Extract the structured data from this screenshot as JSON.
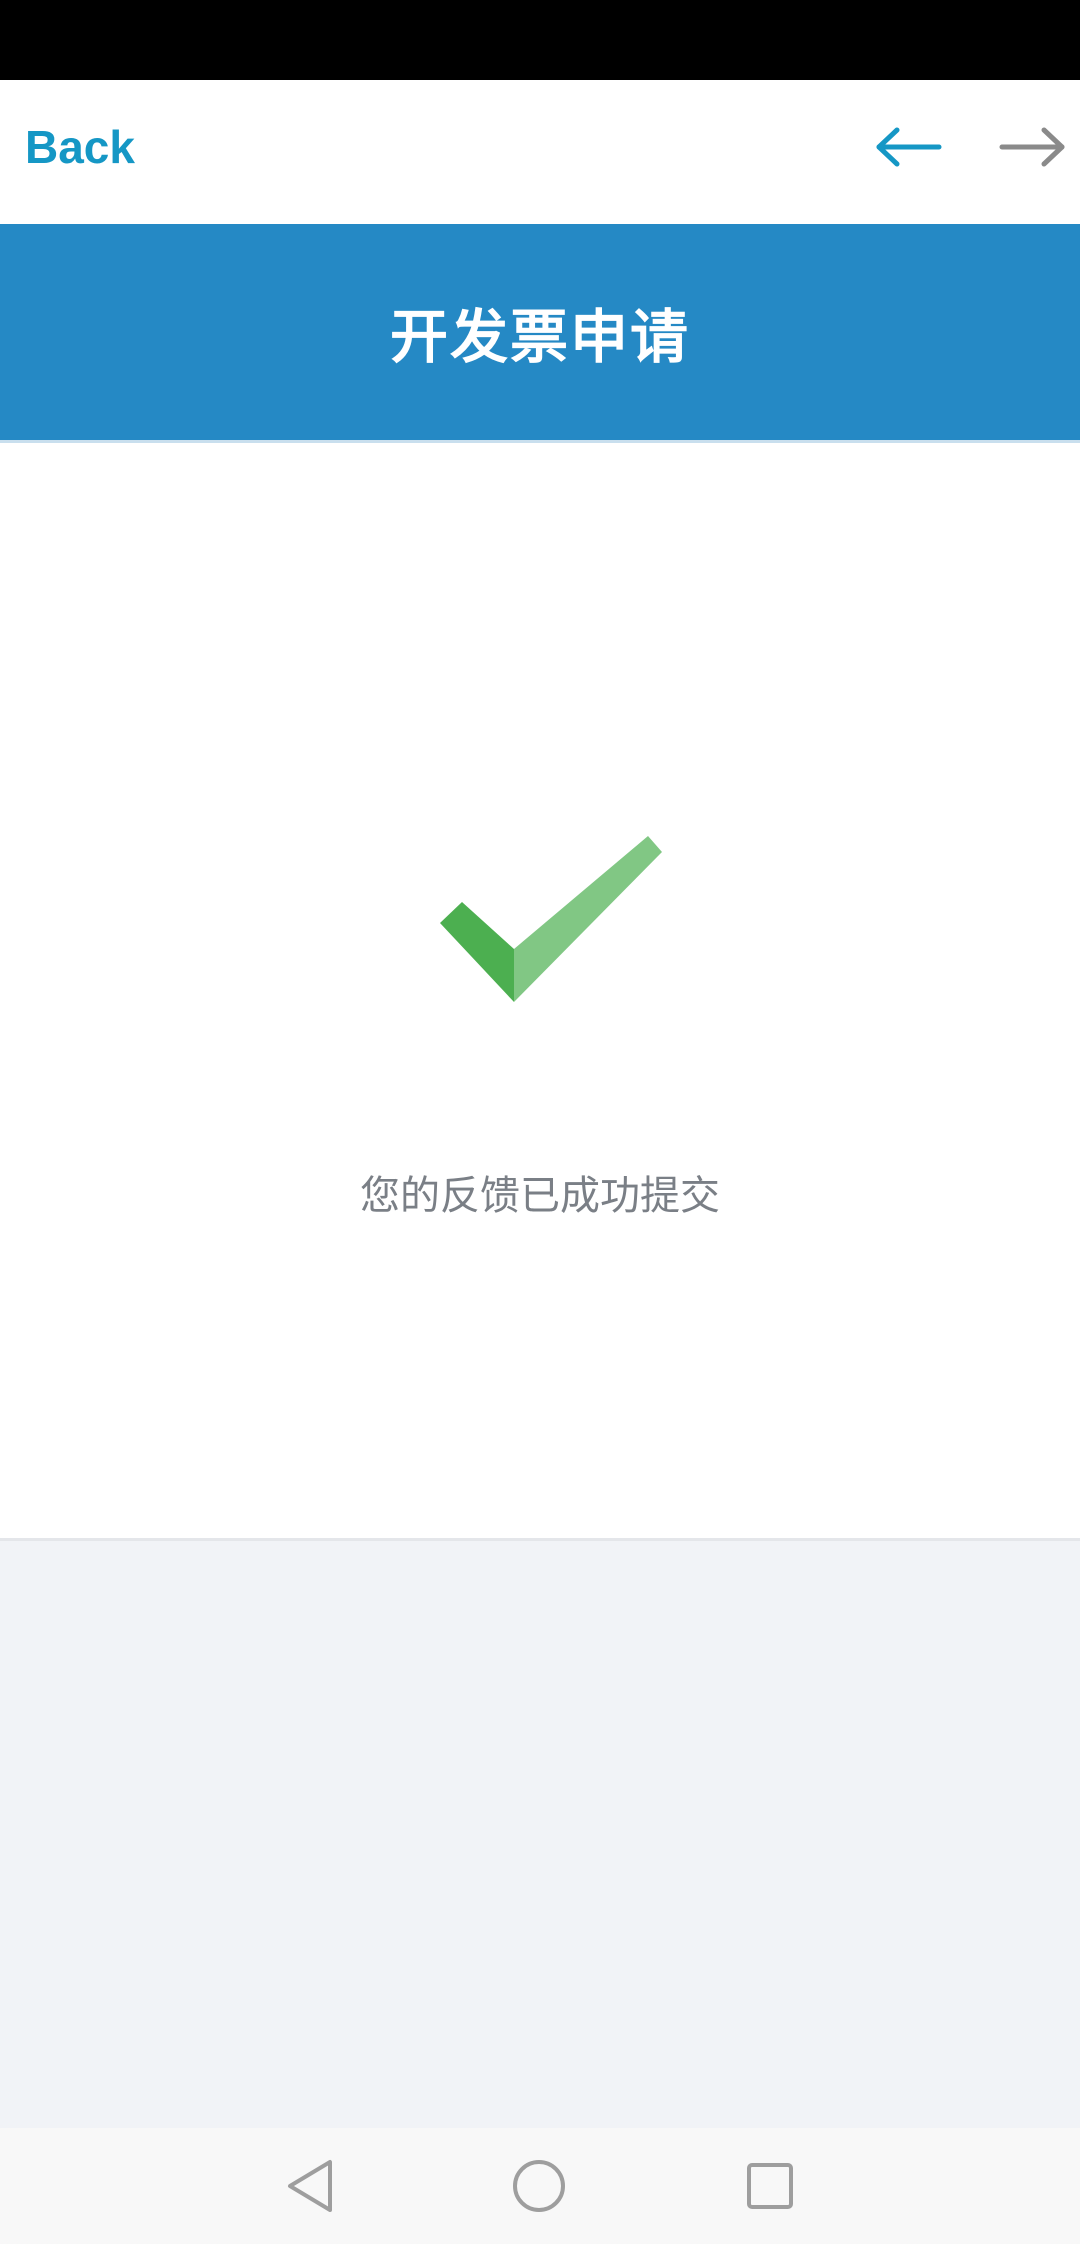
{
  "browser": {
    "back_label": "Back",
    "nav_back_icon": "arrow-left-icon",
    "nav_forward_icon": "arrow-right-icon",
    "accent_color": "#1597c5",
    "inactive_color": "#8a8a8a"
  },
  "header": {
    "title": "开发票申请",
    "background_color": "#2589c5"
  },
  "main": {
    "status_icon": "checkmark-icon",
    "message": "您的反馈已成功提交",
    "success_color": "#4caf50"
  },
  "system_nav": {
    "back_icon": "triangle-back-icon",
    "home_icon": "circle-home-icon",
    "recent_icon": "square-recent-icon"
  }
}
